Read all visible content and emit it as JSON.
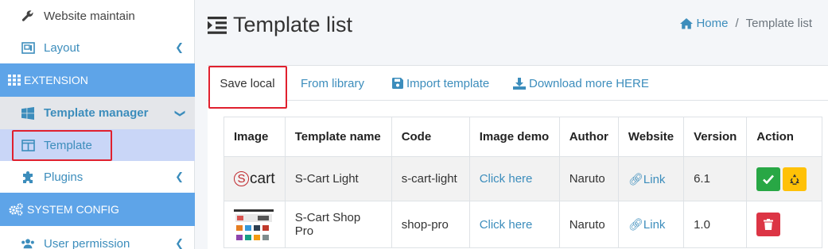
{
  "sidebar": {
    "items": [
      {
        "label": "Website maintain",
        "icon": "wrench-icon"
      },
      {
        "label": "Layout",
        "icon": "layout-icon"
      },
      {
        "label": "Template manager",
        "icon": "windows-icon"
      },
      {
        "label": "Template",
        "icon": "columns-icon"
      },
      {
        "label": "Plugins",
        "icon": "puzzle-icon"
      },
      {
        "label": "User permission",
        "icon": "users-icon"
      }
    ],
    "headers": [
      {
        "label": "EXTENSION",
        "icon": "grid-icon"
      },
      {
        "label": "SYSTEM CONFIG",
        "icon": "cogs-icon"
      }
    ]
  },
  "page": {
    "title": "Template list",
    "breadcrumb": {
      "home": "Home",
      "separator": "/",
      "current": "Template list"
    }
  },
  "tabs": [
    {
      "label": "Save local",
      "active": true
    },
    {
      "label": "From library"
    },
    {
      "label": "Import template",
      "icon": "save-icon"
    },
    {
      "label": "Download more HERE",
      "icon": "download-icon"
    }
  ],
  "table": {
    "headers": [
      "Image",
      "Template name",
      "Code",
      "Image demo",
      "Author",
      "Website",
      "Version",
      "Action"
    ],
    "rows": [
      {
        "image_text": "Scart",
        "name": "S-Cart Light",
        "code": "s-cart-light",
        "demo": "Click here",
        "author": "Naruto",
        "website": "Link",
        "version": "6.1"
      },
      {
        "image_text": "",
        "name": "S-Cart Shop Pro",
        "code": "shop-pro",
        "demo": "Click here",
        "author": "Naruto",
        "website": "Link",
        "version": "1.0"
      }
    ]
  },
  "colors": {
    "accent": "#3c8dbc",
    "sidebar_header": "#5ea4e8",
    "highlight": "#e0202e",
    "success": "#28a745",
    "warning": "#ffc107",
    "danger": "#dc3545"
  }
}
